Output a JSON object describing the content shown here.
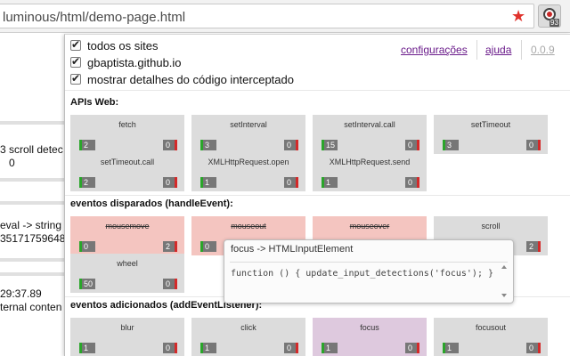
{
  "browser": {
    "url": "luminous/html/demo-page.html",
    "extension_badge": "93"
  },
  "background": {
    "lines": [
      "3 scroll detec",
      "0",
      "eval -> string",
      "35171759648",
      "29:37.89",
      "ternal conten"
    ]
  },
  "popup": {
    "options": [
      {
        "label": "todos os sites",
        "checked": true
      },
      {
        "label": "gbaptista.github.io",
        "checked": true
      },
      {
        "label": "mostrar detalhes do código interceptado",
        "checked": true
      }
    ],
    "links": {
      "config": "configurações",
      "help": "ajuda",
      "version": "0.0.9"
    },
    "sections": {
      "apis": "APIs Web:",
      "dispatched": "eventos disparados (handleEvent):",
      "added": "eventos adicionados (addEventListener):"
    },
    "apis": [
      {
        "name": "fetch",
        "allowed": "2",
        "blocked": "0"
      },
      {
        "name": "setInterval",
        "allowed": "3",
        "blocked": "0"
      },
      {
        "name": "setInterval.call",
        "allowed": "15",
        "blocked": "0"
      },
      {
        "name": "setTimeout",
        "allowed": "3",
        "blocked": "0"
      },
      {
        "name": "setTimeout.call",
        "allowed": "2",
        "blocked": "0"
      },
      {
        "name": "XMLHttpRequest.open",
        "allowed": "1",
        "blocked": "0"
      },
      {
        "name": "XMLHttpRequest.send",
        "allowed": "1",
        "blocked": "0"
      }
    ],
    "dispatched": [
      {
        "name": "mousemove",
        "allowed": "0",
        "blocked": "2"
      },
      {
        "name": "mouseout",
        "allowed": "0",
        "blocked": ""
      },
      {
        "name": "mouseover",
        "allowed": "",
        "blocked": ""
      },
      {
        "name": "scroll",
        "allowed": "",
        "blocked": "2"
      },
      {
        "name": "wheel",
        "allowed": "50",
        "blocked": "0"
      }
    ],
    "added": [
      {
        "name": "blur",
        "allowed": "1",
        "blocked": "0"
      },
      {
        "name": "click",
        "allowed": "1",
        "blocked": "0"
      },
      {
        "name": "focus",
        "allowed": "1",
        "blocked": "0"
      },
      {
        "name": "focusout",
        "allowed": "1",
        "blocked": "0"
      }
    ],
    "tooltip": {
      "title": "focus -> HTMLInputElement",
      "code": "function () { update_input_detections('focus'); }"
    }
  },
  "colors": {
    "card_default": "#dcdcdc",
    "card_dispatched": "#f4c5c0",
    "card_focus": "#dec9de",
    "allowed_marker": "#2aa52a",
    "blocked_marker": "#d42a2a",
    "link": "#6a1b8a"
  }
}
